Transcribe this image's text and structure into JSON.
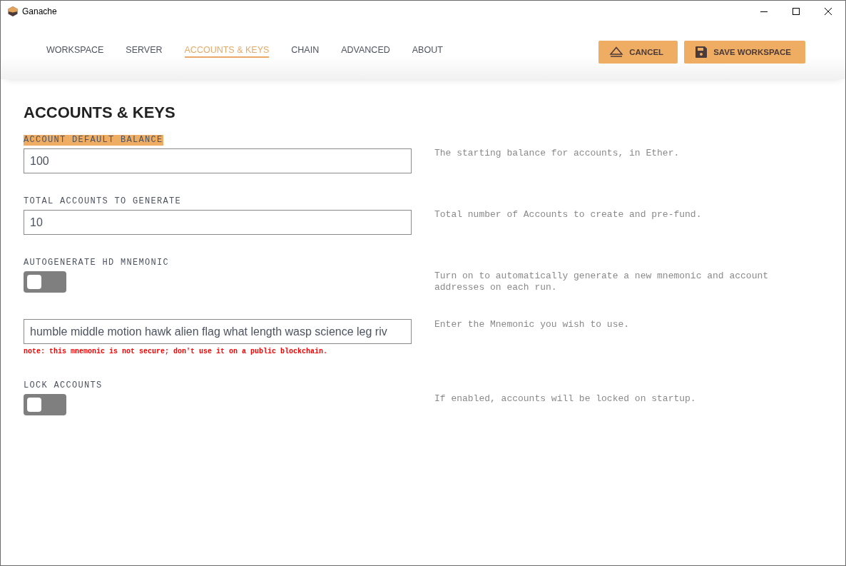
{
  "window": {
    "title": "Ganache"
  },
  "tabs": [
    {
      "label": "WORKSPACE",
      "selected": false
    },
    {
      "label": "SERVER",
      "selected": false
    },
    {
      "label": "ACCOUNTS & KEYS",
      "selected": true
    },
    {
      "label": "CHAIN",
      "selected": false
    },
    {
      "label": "ADVANCED",
      "selected": false
    },
    {
      "label": "ABOUT",
      "selected": false
    }
  ],
  "buttons": [
    {
      "kind": "cancel",
      "label": "CANCEL"
    },
    {
      "kind": "save",
      "label": "SAVE WORKSPACE"
    }
  ],
  "heading": "ACCOUNTS & KEYS",
  "settings": [
    {
      "kind": "input",
      "label": "ACCOUNT DEFAULT BALANCE",
      "highlighted": true,
      "value": "100",
      "description": "The starting balance for accounts, in Ether."
    },
    {
      "kind": "input",
      "label": "TOTAL ACCOUNTS TO GENERATE",
      "highlighted": false,
      "value": "10",
      "description": "Total number of Accounts to create and pre-fund."
    },
    {
      "kind": "toggle",
      "label": "AUTOGENERATE HD MNEMONIC",
      "highlighted": false,
      "on": false,
      "description": "Turn on to automatically generate a new mnemonic and account addresses on each run."
    },
    {
      "kind": "input",
      "value": "humble middle motion hawk alien flag what length wasp science leg riv",
      "note": "note: this mnemonic is not secure; don't use it on a public blockchain.",
      "description": "Enter the Mnemonic you wish to use."
    },
    {
      "kind": "toggle",
      "label": "LOCK ACCOUNTS",
      "highlighted": false,
      "on": false,
      "description": "If enabled, accounts will be locked on startup."
    }
  ]
}
